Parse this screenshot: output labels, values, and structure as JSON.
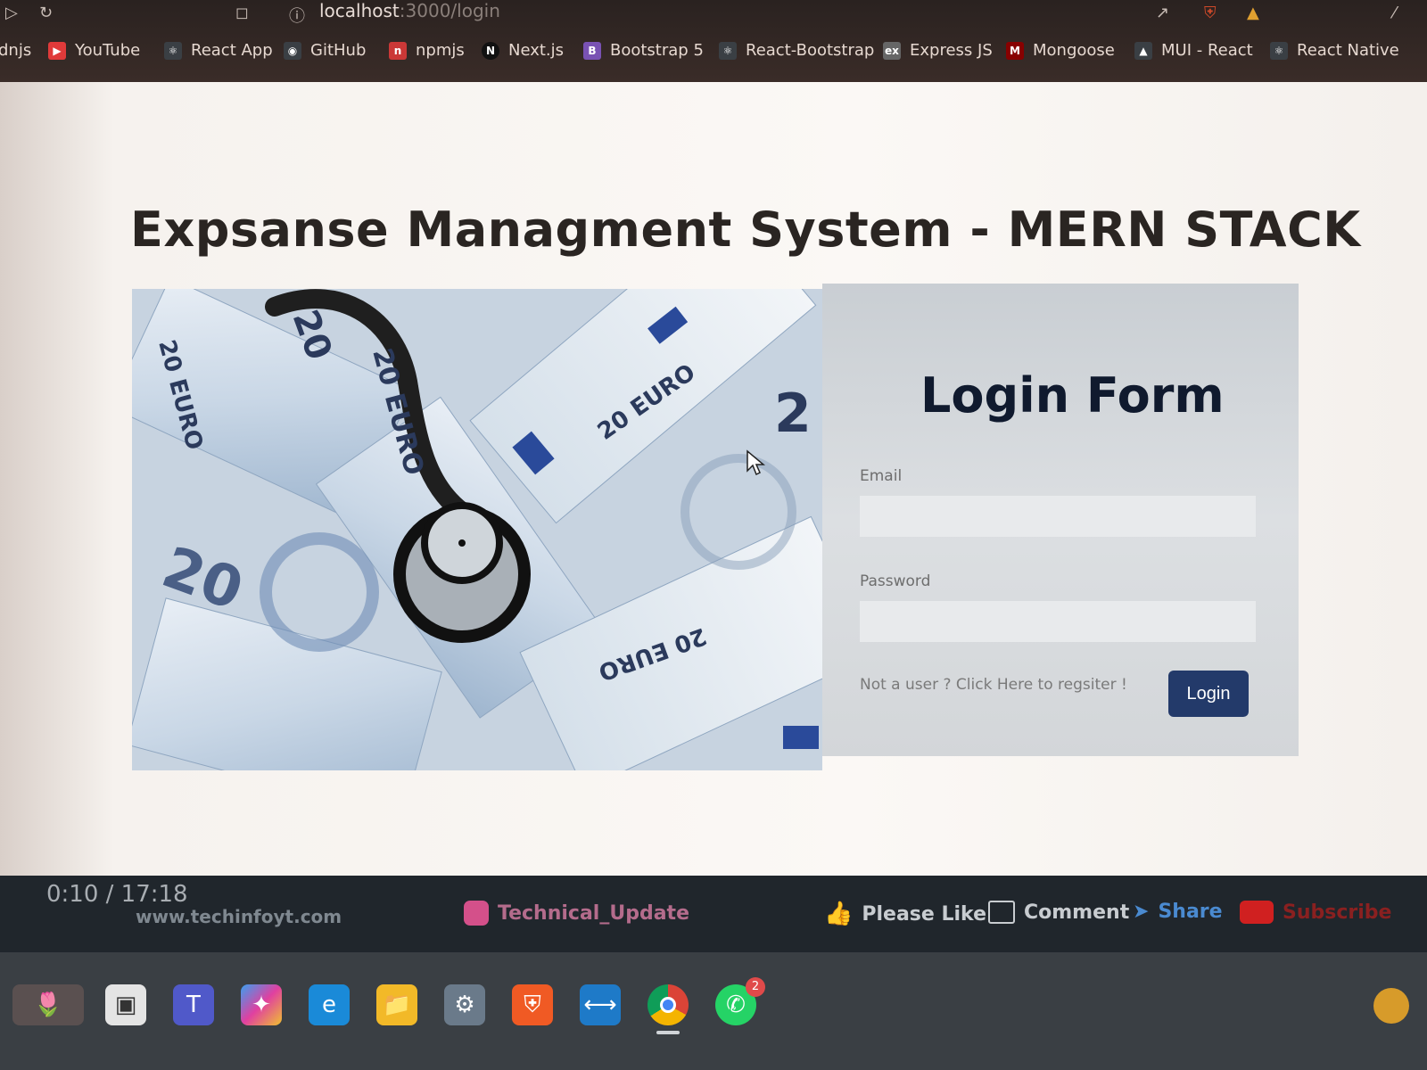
{
  "browser": {
    "url_host": "localhost",
    "url_path": ":3000/login",
    "bookmarks": [
      {
        "label": "YouTube",
        "icon": "youtube-icon",
        "color": "#e03a3a"
      },
      {
        "label": "React App",
        "icon": "react-icon",
        "color": "#3a3f44"
      },
      {
        "label": "GitHub",
        "icon": "github-icon",
        "color": "#3a3f44"
      },
      {
        "label": "npmjs",
        "icon": "npm-icon",
        "color": "#cb3837"
      },
      {
        "label": "Next.js",
        "icon": "nextjs-icon",
        "color": "#111111"
      },
      {
        "label": "Bootstrap 5",
        "icon": "bootstrap-icon",
        "color": "#7952b3"
      },
      {
        "label": "React-Bootstrap",
        "icon": "react-icon",
        "color": "#3a3f44"
      },
      {
        "label": "Express JS",
        "icon": "express-icon",
        "color": "#444444"
      },
      {
        "label": "Mongoose",
        "icon": "mongoose-icon",
        "color": "#880000"
      },
      {
        "label": "MUI - React",
        "icon": "mui-icon",
        "color": "#3a3f44"
      },
      {
        "label": "React Native",
        "icon": "react-icon",
        "color": "#3a3f44"
      }
    ],
    "bookmarks_partial": "dnjs"
  },
  "page": {
    "title": "Expsanse Managment System - MERN STACK",
    "login": {
      "title": "Login Form",
      "email_label": "Email",
      "email_value": "",
      "password_label": "Password",
      "password_value": "",
      "register_link": "Not a user ? Click Here to regsiter !",
      "login_button": "Login",
      "button_color": "#233a6a"
    },
    "photo": {
      "icon": "euro-stethoscope-photo",
      "printed_text": [
        "20 EURO",
        "20 EURO",
        "20 EURO",
        "20 EURO",
        "20",
        "20",
        "2"
      ]
    }
  },
  "video_overlay": {
    "time": "0:10 / 17:18",
    "site": "www.techinfoyt.com",
    "instagram": "Technical_Update",
    "like": "Please Like",
    "comment": "Comment",
    "share": "Share",
    "subscribe": "Subscribe"
  },
  "taskbar": {
    "icons": [
      "widgets-icon",
      "task-view-icon",
      "teams-icon",
      "copilot-icon",
      "edge-icon",
      "file-explorer-icon",
      "settings-icon",
      "brave-icon",
      "vscode-icon",
      "chrome-icon",
      "whatsapp-icon"
    ],
    "whatsapp_badge": "2"
  }
}
